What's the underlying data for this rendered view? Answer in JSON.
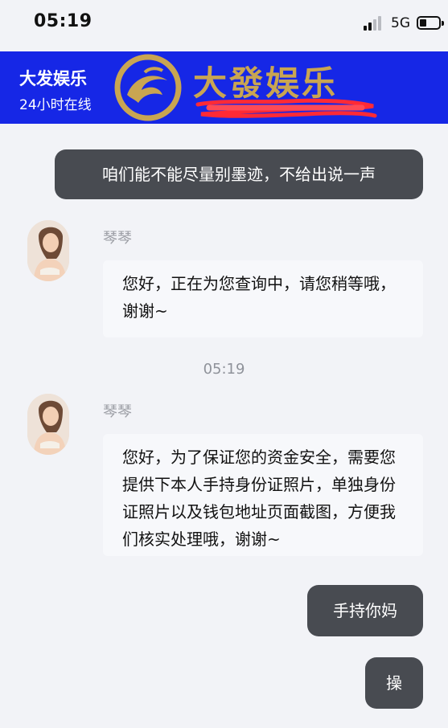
{
  "status_bar": {
    "time": "05:19",
    "network": "5G"
  },
  "header": {
    "title": "大发娱乐",
    "subtitle": "24小时在线",
    "brand_text": "大發娱乐"
  },
  "messages": {
    "out_1": "咱们能不能尽量别墨迹，不给出说一声",
    "agent_1": {
      "name": "琴琴",
      "text": "您好，正在为您查询中，请您稍等哦，谢谢~"
    },
    "time_1": "05:19",
    "agent_2": {
      "name": "琴琴",
      "text": "您好，为了保证您的资金安全，需要您提供下本人手持身份证照片，单独身份证照片以及钱包地址页面截图，方便我们核实处理哦，谢谢~"
    },
    "out_2": "手持你妈",
    "out_3": "操"
  },
  "colors": {
    "header_bg": "#1627e6",
    "brand_gold": "#c9a552",
    "bubble_out": "#484b51",
    "page_bg": "#f2f3f7"
  }
}
